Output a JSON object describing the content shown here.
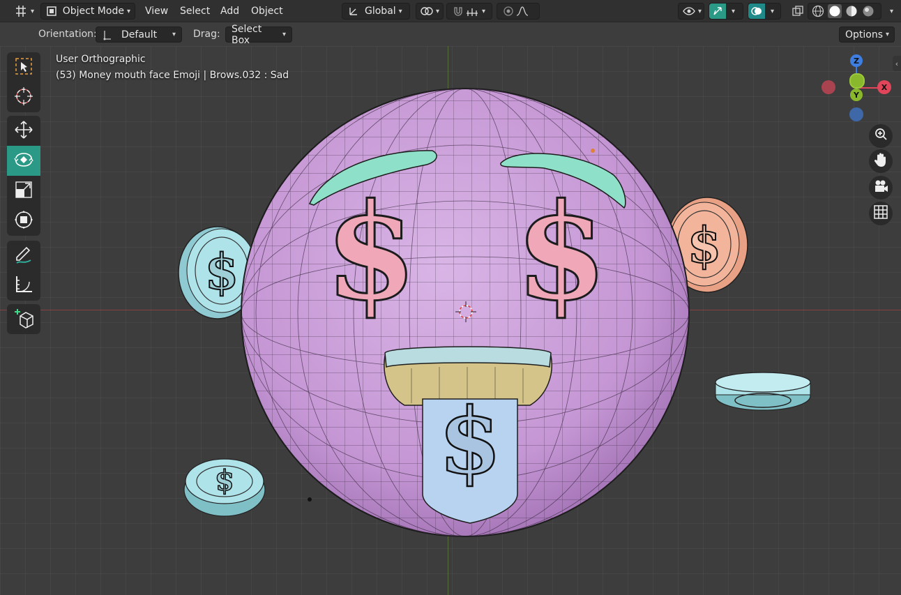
{
  "header": {
    "mode": "Object Mode",
    "menus": [
      "View",
      "Select",
      "Add",
      "Object"
    ],
    "transform_orientation": "Global"
  },
  "tool_settings": {
    "orientation_label": "Orientation:",
    "orientation_value": "Default",
    "drag_label": "Drag:",
    "drag_value": "Select Box",
    "options_label": "Options"
  },
  "viewport": {
    "view_name": "User Orthographic",
    "object_info": "(53) Money mouth face Emoji | Brows.032 : Sad"
  },
  "gizmo": {
    "z": "Z",
    "y": "Y",
    "x": "X"
  },
  "left_tools": [
    "select-box",
    "cursor",
    "move",
    "rotate",
    "scale",
    "transform",
    "annotate",
    "measure",
    "add-cube"
  ],
  "active_tool": "rotate",
  "right_nav": [
    "zoom",
    "pan",
    "camera",
    "perspective-toggle"
  ],
  "colors": {
    "active_tool": "#2a9a86",
    "face": "#c79bd6",
    "brows": "#8fe0c8",
    "dollar": "#f0a8b8",
    "coin_blue": "#aee3ea",
    "coin_peach": "#f2b59c",
    "tongue": "#b8d3f0",
    "gizmo_x": "#e0455a",
    "gizmo_y": "#8ab82c",
    "gizmo_z": "#3d7ee0"
  }
}
